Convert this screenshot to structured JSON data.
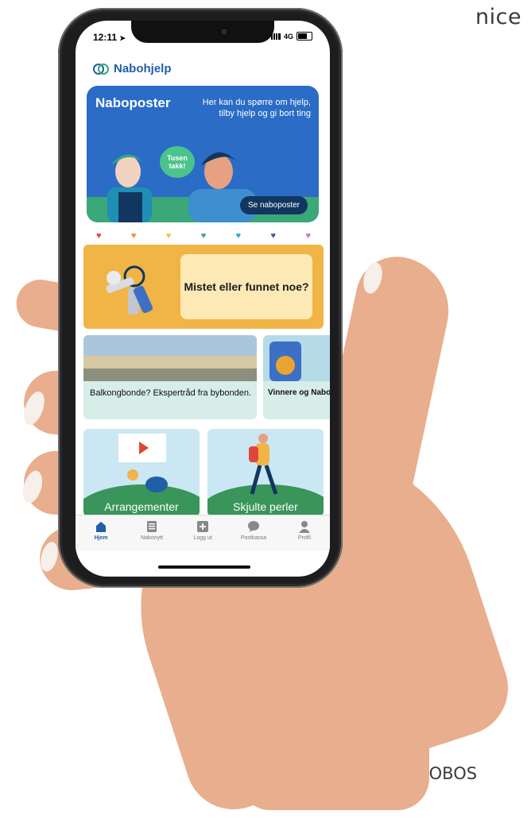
{
  "caption": {
    "top_right": "nice",
    "credit": "Photo: OBOS"
  },
  "status_bar": {
    "time": "12:11",
    "network": "4G"
  },
  "app": {
    "name": "Nabohjelp",
    "brand_color": "#1f5fa6"
  },
  "nabo_card": {
    "title": "Naboposter",
    "description": "Her kan du spørre om hjelp, tilby hjelp og gi bort ting",
    "bubble": "Tusen takk!",
    "button": "Se naboposter",
    "color": "#2a6cc6"
  },
  "hearts": [
    "#e0443b",
    "#ef8b33",
    "#f2c23b",
    "#3aa878",
    "#2aa7db",
    "#3b55a8",
    "#c772c7"
  ],
  "lost_card": {
    "text": "Mistet eller funnet noe?",
    "color": "#f0b546"
  },
  "articles": [
    {
      "title": "Balkongbonde? Ekspertråd fra bybonden."
    },
    {
      "title": "Vinnere og Nabohjelpla"
    }
  ],
  "tiles": [
    {
      "label": "Arrangementer"
    },
    {
      "label": "Skjulte perler"
    }
  ],
  "tabs": [
    {
      "label": "Hjem",
      "icon": "home-icon",
      "active": true
    },
    {
      "label": "Nabonytt",
      "icon": "news-icon"
    },
    {
      "label": "Logg ut",
      "icon": "plus-icon"
    },
    {
      "label": "Postkassa",
      "icon": "chat-icon"
    },
    {
      "label": "Profil",
      "icon": "person-icon"
    }
  ]
}
